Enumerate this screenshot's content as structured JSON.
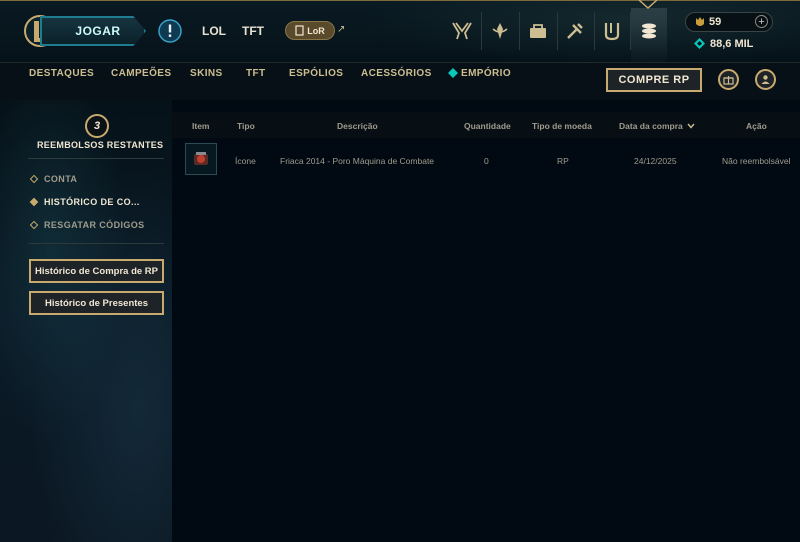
{
  "topbar": {
    "play_label": "JOGAR",
    "nav": [
      "LOL",
      "TFT"
    ],
    "lor_label": "LoR",
    "ext_arrow": "↗",
    "icons": [
      "clash-icon",
      "missions-icon",
      "collection-icon",
      "loot-icon",
      "profile-icon",
      "store-icon"
    ]
  },
  "currency": {
    "rp": "59",
    "be": "88,6 MIL",
    "plus": "+"
  },
  "subnav": {
    "items": [
      "DESTAQUES",
      "CAMPEÕES",
      "SKINS",
      "TFT",
      "ESPÓLIOS",
      "ACESSÓRIOS",
      "EMPÓRIO"
    ],
    "buy_rp": "COMPRE RP"
  },
  "sidebar": {
    "refund_count": "3",
    "refund_label": "REEMBOLSOS RESTANTES",
    "items": [
      "CONTA",
      "HISTÓRICO DE CO...",
      "RESGATAR CÓDIGOS"
    ],
    "buttons": [
      "Histórico de Compra de RP",
      "Histórico de Presentes"
    ]
  },
  "table": {
    "headers": [
      "Item",
      "Tipo",
      "Descrição",
      "Quantidade",
      "Tipo de moeda",
      "Data da compra",
      "Ação"
    ],
    "rows": [
      {
        "tipo": "Ícone",
        "descricao": "Friaca 2014 - Poro Máquina de Combate",
        "quantidade": "0",
        "moeda": "RP",
        "data": "24/12/2025",
        "acao": "Não reembolsável"
      }
    ]
  },
  "colors": {
    "gold": "#c8aa6e",
    "teal": "#0ac8b9",
    "bg": "#010a13"
  }
}
